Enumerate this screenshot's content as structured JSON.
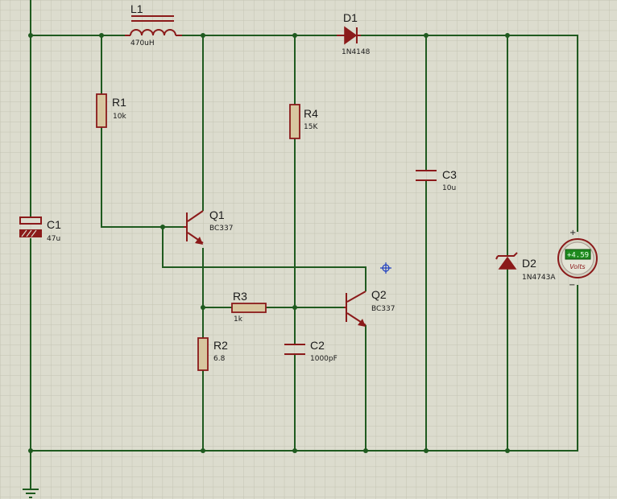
{
  "components": {
    "L1": {
      "ref": "L1",
      "value": "470uH"
    },
    "D1": {
      "ref": "D1",
      "value": "1N4148"
    },
    "R1": {
      "ref": "R1",
      "value": "10k"
    },
    "R4": {
      "ref": "R4",
      "value": "15K"
    },
    "C3": {
      "ref": "C3",
      "value": "10u"
    },
    "C1": {
      "ref": "C1",
      "value": "47u"
    },
    "Q1": {
      "ref": "Q1",
      "value": "BC337"
    },
    "D2": {
      "ref": "D2",
      "value": "1N4743A"
    },
    "R3": {
      "ref": "R3",
      "value": "1k"
    },
    "Q2": {
      "ref": "Q2",
      "value": "BC337"
    },
    "R2": {
      "ref": "R2",
      "value": "6.8"
    },
    "C2": {
      "ref": "C2",
      "value": "1000pF"
    }
  },
  "voltmeter": {
    "reading": "+4.59",
    "unit": "Volts",
    "plus": "+",
    "minus": "−"
  },
  "colors": {
    "background": "#dcdcce",
    "grid": "#c3c3b3",
    "wire": "#1f5a1f",
    "component": "#8b1a1a",
    "meter_display": "#1e8a1e"
  }
}
